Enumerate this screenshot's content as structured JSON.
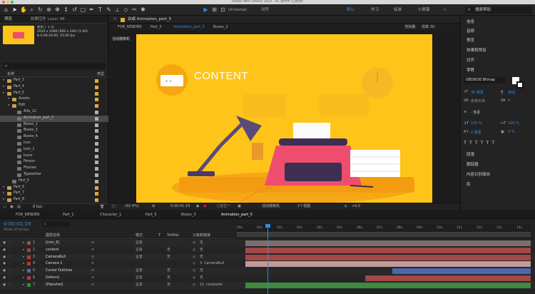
{
  "window": {
    "title": "Adobe After Effects 2020 - AE 源文件 (已修改)"
  },
  "toolbar": {
    "workspaces": [
      "默认",
      "学习",
      "标准",
      "小屏幕"
    ],
    "snap": "对齐",
    "axis": "Universal",
    "search": "搜索帮助"
  },
  "project": {
    "tab_project": "项目",
    "tab_effects": "效果控件 Layer 98",
    "thumb_info": "使用了 1 次",
    "thumb_line2": "2020 x 1080 (960 x 540) (1.00)",
    "thumb_line3": "Δ 0:00:16:00, 25.00 fps",
    "col_name": "名称",
    "col_type": "类型",
    "items": [
      {
        "name": "Part_3",
        "indent": 0,
        "color": "#e5a83a",
        "type": "folder"
      },
      {
        "name": "Part_4",
        "indent": 0,
        "color": "#e5a83a",
        "type": "folder"
      },
      {
        "name": "Part_5",
        "indent": 0,
        "color": "#e5a83a",
        "type": "folder"
      },
      {
        "name": "Assets",
        "indent": 1,
        "color": "#e5a83a",
        "type": "folder"
      },
      {
        "name": "Edit",
        "indent": 1,
        "color": "#e5a83a",
        "type": "folder"
      },
      {
        "name": "Alfa_12",
        "indent": 2,
        "color": "#b0b0b0",
        "type": "comp"
      },
      {
        "name": "Animation_part_5",
        "indent": 2,
        "color": "#b0b0b0",
        "type": "comp",
        "selected": true
      },
      {
        "name": "Boxes_1",
        "indent": 2,
        "color": "#b0b0b0",
        "type": "comp"
      },
      {
        "name": "Boxes_3",
        "indent": 2,
        "color": "#b0b0b0",
        "type": "comp"
      },
      {
        "name": "Boxes_4",
        "indent": 2,
        "color": "#b0b0b0",
        "type": "comp"
      },
      {
        "name": "Icon",
        "indent": 2,
        "color": "#b0b0b0",
        "type": "comp"
      },
      {
        "name": "Icon_1",
        "indent": 2,
        "color": "#b0b0b0",
        "type": "comp"
      },
      {
        "name": "Icons",
        "indent": 2,
        "color": "#b0b0b0",
        "type": "comp"
      },
      {
        "name": "Person",
        "indent": 2,
        "color": "#b0b0b0",
        "type": "comp"
      },
      {
        "name": "Phonee",
        "indent": 2,
        "color": "#b0b0b0",
        "type": "comp"
      },
      {
        "name": "Typewriter",
        "indent": 2,
        "color": "#b0b0b0",
        "type": "comp"
      },
      {
        "name": "Part_5",
        "indent": 1,
        "color": "#b0b0b0",
        "type": "comp"
      },
      {
        "name": "Part_6",
        "indent": 0,
        "color": "#e5a83a",
        "type": "folder"
      },
      {
        "name": "Part_7",
        "indent": 0,
        "color": "#e5a83a",
        "type": "folder"
      },
      {
        "name": "Part_8",
        "indent": 0,
        "color": "#e5a83a",
        "type": "folder"
      }
    ],
    "bpc": "8 bpc"
  },
  "viewer": {
    "tab": "合成 Animation_part_5",
    "crumbs": [
      "FOR_RENDER",
      "Part_5",
      "Animation_part_5",
      "Boxes_2"
    ],
    "renderer": "渲染器:",
    "renderer_val": "经典 3D",
    "active_cam": "活动摄像机",
    "canvas_text": "CONTENT",
    "zoom": "(92.4%)",
    "timecode": "0:00:01:19",
    "resolution": "二分之一",
    "view": "活动摄像机",
    "views": "1个视图",
    "exposure": "+0.0"
  },
  "right": {
    "panels": [
      "信息",
      "音频",
      "预览",
      "效果和预设",
      "对齐",
      "字符"
    ],
    "font": "GB18030 Bitmap",
    "font_size": "36 像素",
    "leading": "自动",
    "tracking_label": "度量标准",
    "tracking_val": "0",
    "stroke": "- 像素",
    "vscale": "100 %",
    "hscale": "100 %",
    "baseline": "0 像素",
    "tsume": "0 %",
    "lower": [
      "段落",
      "跟踪器",
      "内容识别填充",
      "库"
    ]
  },
  "timeline": {
    "tabs": [
      "FOR_RENDER",
      "Part_1",
      "Character_1",
      "Part_5",
      "Boxes_3",
      "Animation_part_5"
    ],
    "timecode": "0:00:01:19",
    "frames": "00044 (25.00 fps)",
    "col_name": "图层名称",
    "col_mode": "模式",
    "col_t": "T",
    "col_trk": "TrkMat",
    "col_parent": "父级和链接",
    "ruler": [
      "00s",
      "01s",
      "02s",
      "03s",
      "04s",
      "05s",
      "06s",
      "07s",
      "08s",
      "09s",
      "10s",
      "11s",
      "12s",
      "13s",
      "14s"
    ],
    "layers": [
      {
        "num": "1",
        "name": "[icon_6]",
        "mode": "正常",
        "trk": "",
        "parent": "无",
        "color": "#8f5252",
        "bar": "#7b6e6e"
      },
      {
        "num": "2",
        "name": "content",
        "mode": "正常",
        "trk": "无",
        "parent": "无",
        "color": "#b23b3b",
        "bar": "#a34747"
      },
      {
        "num": "3",
        "name": "CameraNull",
        "mode": "正常",
        "trk": "无",
        "parent": "无",
        "color": "#b23b3b",
        "bar": "#a34747"
      },
      {
        "num": "4",
        "name": "Camera 1",
        "mode": "",
        "trk": "",
        "parent": "3. CameraNull",
        "color": "#b23b3b",
        "bar": "#c09a9a"
      },
      {
        "num": "5",
        "name": "Cursor Outlines",
        "mode": "正常",
        "trk": "无",
        "parent": "无",
        "color": "#4a6cb0",
        "bar": "#4b68ad"
      },
      {
        "num": "6",
        "name": "[letters]",
        "mode": "正常",
        "trk": "无",
        "parent": "无",
        "color": "#b23b3b",
        "bar": "#a34747"
      },
      {
        "num": "7",
        "name": "[Planshet]",
        "mode": "正常",
        "trk": "无",
        "parent": "11. computer",
        "color": "#3a8a3a",
        "bar": "#3f8a3f"
      }
    ]
  },
  "colors": {
    "accent": "#2d8ceb",
    "canvas": "#ffc419",
    "typewriter": "#ef4d6e",
    "lamp": "#5a4a78"
  }
}
